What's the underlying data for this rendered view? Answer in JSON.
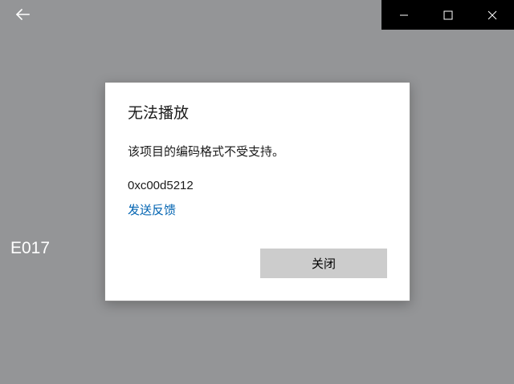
{
  "window": {
    "back_icon": "arrow-left-icon",
    "caption_icons": [
      "minimize-icon",
      "maximize-icon",
      "close-icon"
    ]
  },
  "side_label": "E017",
  "dialog": {
    "title": "无法播放",
    "message": "该项目的编码格式不受支持。",
    "error_code": "0xc00d5212",
    "feedback_link": "发送反馈",
    "close_button": "关闭"
  },
  "colors": {
    "background": "#949597",
    "caption_bar": "#000000",
    "dialog": "#ffffff",
    "link": "#0063b1",
    "button": "#cccccc"
  }
}
